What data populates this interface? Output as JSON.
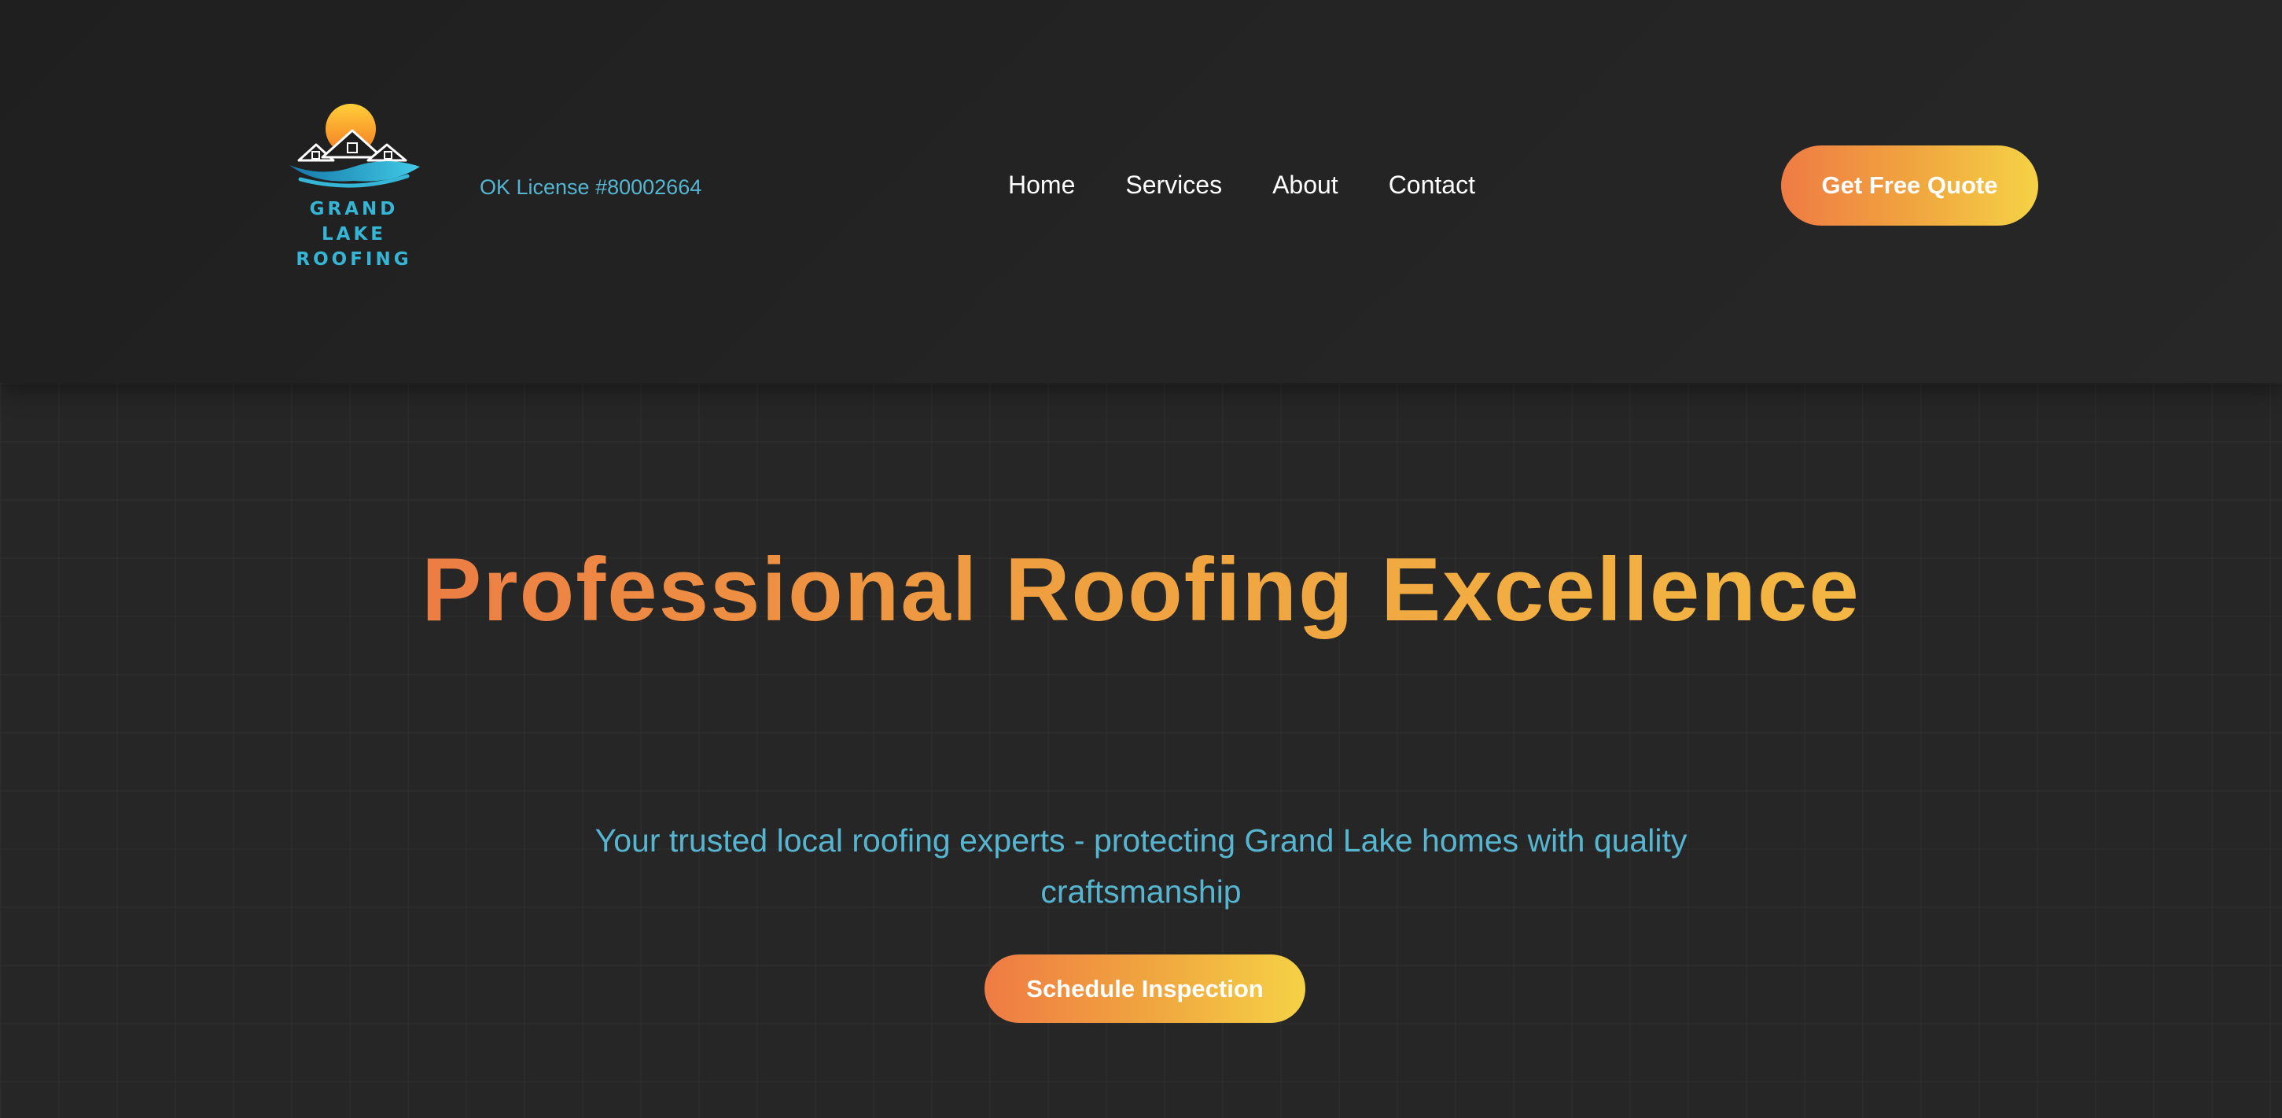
{
  "header": {
    "logo": {
      "icon": "sun-over-roofs-and-waves-logo",
      "text": "GRAND LAKE\nROOFING"
    },
    "license": "OK License #80002664",
    "nav": [
      {
        "label": "Home"
      },
      {
        "label": "Services"
      },
      {
        "label": "About"
      },
      {
        "label": "Contact"
      }
    ],
    "cta_label": "Get Free Quote"
  },
  "hero": {
    "title": "Professional Roofing Excellence",
    "subtitle": "Your trusted local roofing experts - protecting Grand Lake homes with quality craftsmanship",
    "cta_label": "Schedule Inspection"
  },
  "colors": {
    "background": "#252525",
    "accent_orange": "#ef7b44",
    "accent_yellow": "#f5d245",
    "accent_cyan": "#35b6d6",
    "nav_text": "#ffffff"
  }
}
